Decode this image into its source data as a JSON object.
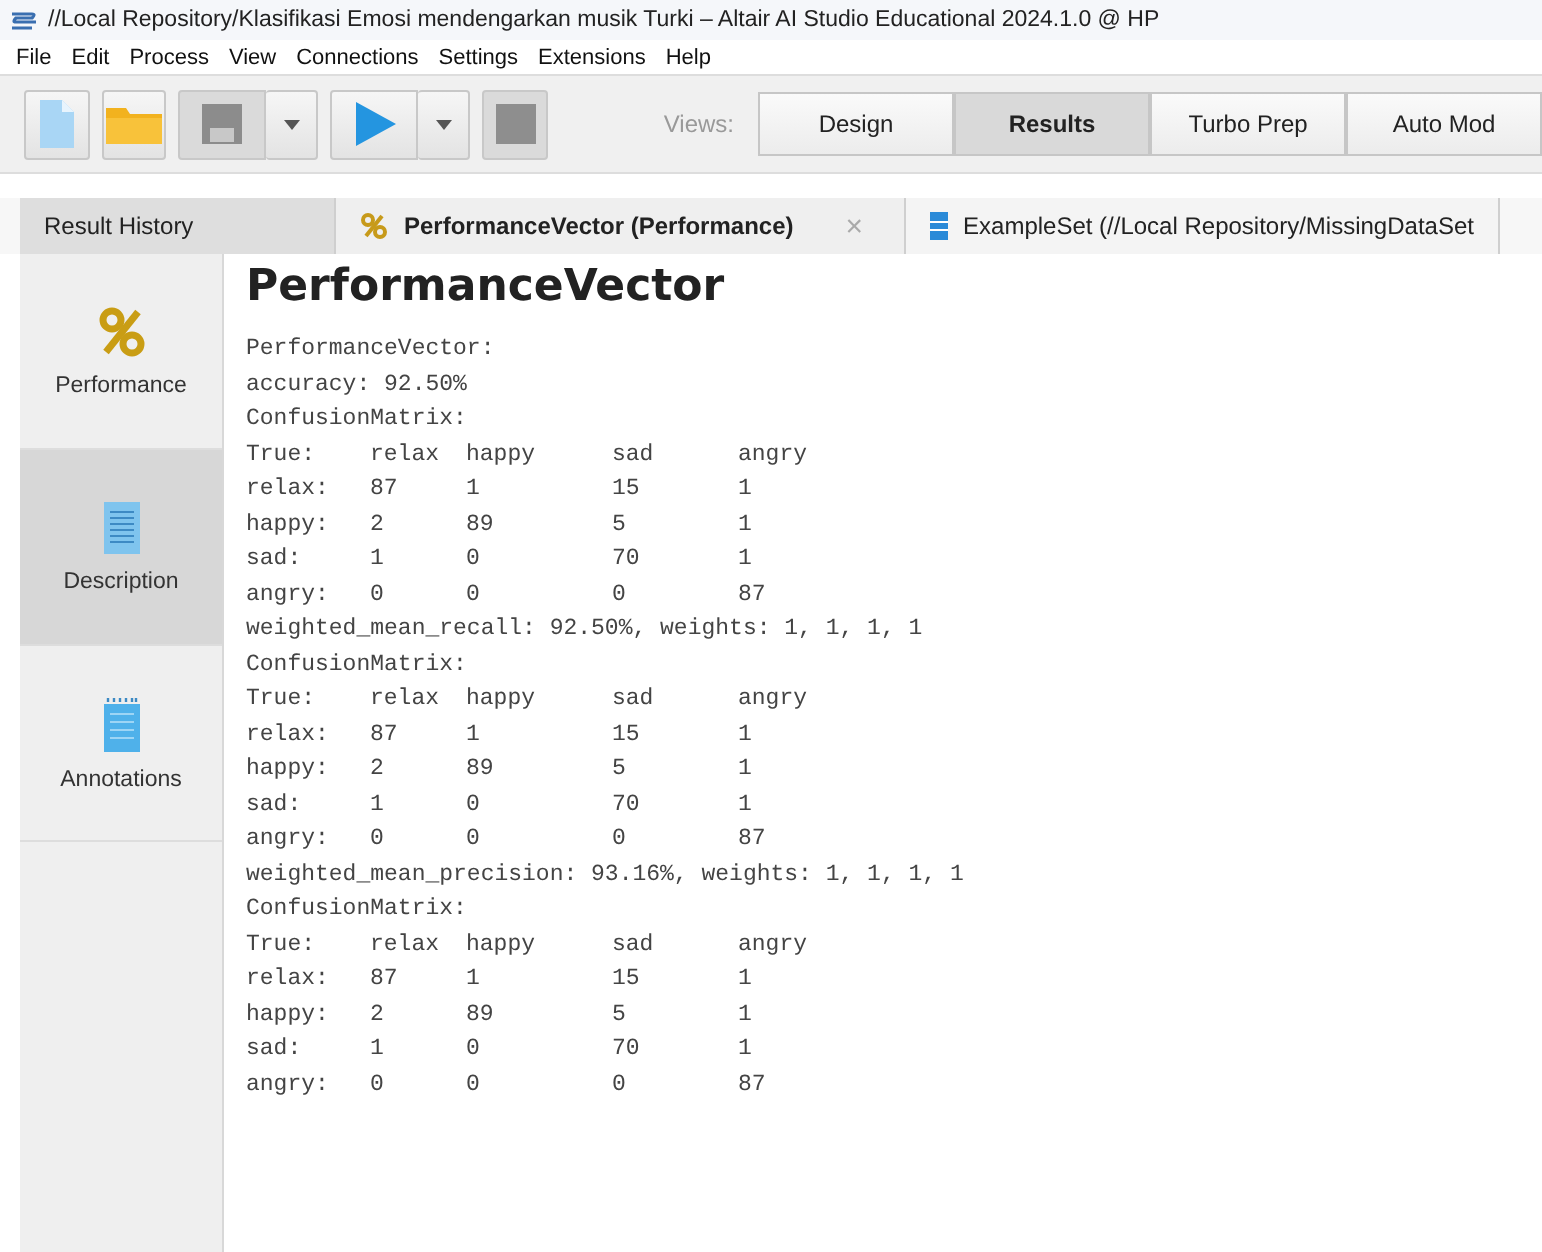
{
  "window": {
    "title": "//Local Repository/Klasifikasi Emosi mendengarkan musik Turki  – Altair AI Studio Educational 2024.1.0 @ HP"
  },
  "menu": [
    "File",
    "Edit",
    "Process",
    "View",
    "Connections",
    "Settings",
    "Extensions",
    "Help"
  ],
  "toolbar": {
    "views_label": "Views:",
    "views": [
      {
        "label": "Design",
        "selected": false
      },
      {
        "label": "Results",
        "selected": true
      },
      {
        "label": "Turbo Prep",
        "selected": false
      },
      {
        "label": "Auto Mod",
        "selected": false
      }
    ]
  },
  "tabs": [
    {
      "label": "Result History",
      "kind": "plain",
      "selected": false
    },
    {
      "label": "PerformanceVector (Performance)",
      "kind": "performance",
      "selected": true,
      "close": "×"
    },
    {
      "label": "ExampleSet (//Local Repository/MissingDataSet",
      "kind": "data",
      "selected": false
    }
  ],
  "sidebar": {
    "items": [
      {
        "label": "Performance",
        "kind": "percent",
        "highlighted": false
      },
      {
        "label": "Description",
        "kind": "document",
        "highlighted": true
      },
      {
        "label": "Annotations",
        "kind": "notepad",
        "highlighted": false
      }
    ]
  },
  "content": {
    "title": "PerformanceVector",
    "lines": [
      {
        "kind": "text",
        "text": "PerformanceVector:"
      },
      {
        "kind": "text",
        "text": "accuracy: 92.50%"
      },
      {
        "kind": "text",
        "text": "ConfusionMatrix:"
      },
      {
        "kind": "row",
        "cells": [
          "True:",
          "relax",
          "happy",
          "sad",
          "angry"
        ]
      },
      {
        "kind": "row",
        "cells": [
          "relax:",
          "87",
          "1",
          "15",
          "1"
        ]
      },
      {
        "kind": "row",
        "cells": [
          "happy:",
          "2",
          "89",
          "5",
          "1"
        ]
      },
      {
        "kind": "row",
        "cells": [
          "sad:",
          "1",
          "0",
          "70",
          "1"
        ]
      },
      {
        "kind": "row",
        "cells": [
          "angry:",
          "0",
          "0",
          "0",
          "87"
        ]
      },
      {
        "kind": "text",
        "text": "weighted_mean_recall: 92.50%, weights: 1, 1, 1, 1"
      },
      {
        "kind": "text",
        "text": "ConfusionMatrix:"
      },
      {
        "kind": "row",
        "cells": [
          "True:",
          "relax",
          "happy",
          "sad",
          "angry"
        ]
      },
      {
        "kind": "row",
        "cells": [
          "relax:",
          "87",
          "1",
          "15",
          "1"
        ]
      },
      {
        "kind": "row",
        "cells": [
          "happy:",
          "2",
          "89",
          "5",
          "1"
        ]
      },
      {
        "kind": "row",
        "cells": [
          "sad:",
          "1",
          "0",
          "70",
          "1"
        ]
      },
      {
        "kind": "row",
        "cells": [
          "angry:",
          "0",
          "0",
          "0",
          "87"
        ]
      },
      {
        "kind": "text",
        "text": "weighted_mean_precision: 93.16%, weights: 1, 1, 1, 1"
      },
      {
        "kind": "text",
        "text": "ConfusionMatrix:"
      },
      {
        "kind": "row",
        "cells": [
          "True:",
          "relax",
          "happy",
          "sad",
          "angry"
        ]
      },
      {
        "kind": "row",
        "cells": [
          "relax:",
          "87",
          "1",
          "15",
          "1"
        ]
      },
      {
        "kind": "row",
        "cells": [
          "happy:",
          "2",
          "89",
          "5",
          "1"
        ]
      },
      {
        "kind": "row",
        "cells": [
          "sad:",
          "1",
          "0",
          "70",
          "1"
        ]
      },
      {
        "kind": "row",
        "cells": [
          "angry:",
          "0",
          "0",
          "0",
          "87"
        ]
      }
    ]
  }
}
